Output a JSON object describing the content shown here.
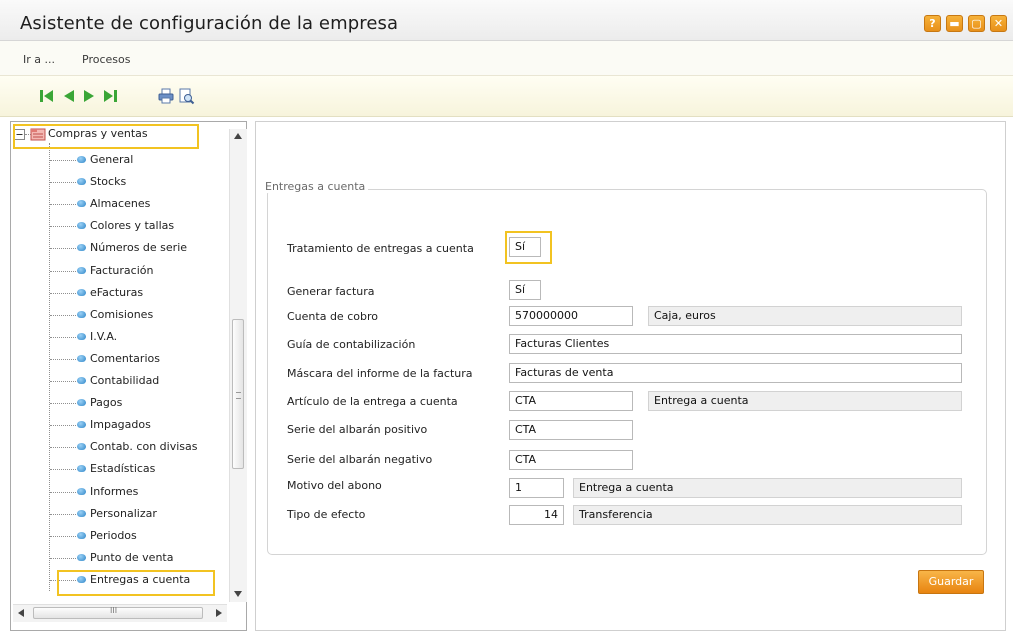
{
  "window": {
    "title": "Asistente de configuración de la empresa",
    "buttons": [
      {
        "name": "help",
        "glyph": "?"
      },
      {
        "name": "minimize",
        "glyph": "▬"
      },
      {
        "name": "maximize",
        "glyph": "▢"
      },
      {
        "name": "close",
        "glyph": "✕"
      }
    ]
  },
  "menu": {
    "items": [
      "Ir a ...",
      "Procesos"
    ]
  },
  "toolbar": {
    "icons": [
      "first-record-icon",
      "previous-record-icon",
      "next-record-icon",
      "last-record-icon",
      "print-icon",
      "print-preview-icon"
    ]
  },
  "tree": {
    "root": "Compras y ventas",
    "items": [
      "General",
      "Stocks",
      "Almacenes",
      "Colores y tallas",
      "Números de serie",
      "Facturación",
      "eFacturas",
      "Comisiones",
      "I.V.A.",
      "Comentarios",
      "Contabilidad",
      "Pagos",
      "Impagados",
      "Contab. con divisas",
      "Estadísticas",
      "Informes",
      "Personalizar",
      "Periodos",
      "Punto de venta",
      "Entregas a cuenta"
    ],
    "hscroll_mark": "III"
  },
  "form": {
    "group_title": "Entregas a cuenta",
    "tratamiento": {
      "label": "Tratamiento de entregas a cuenta",
      "value": "Sí"
    },
    "generar_factura": {
      "label": "Generar factura",
      "value": "Sí"
    },
    "cuenta_cobro": {
      "label": "Cuenta de cobro",
      "value": "570000000",
      "desc": "Caja, euros"
    },
    "guia": {
      "label": "Guía de contabilización",
      "value": "Facturas Clientes"
    },
    "mascara": {
      "label": "Máscara del informe de la factura",
      "value": "Facturas de venta"
    },
    "articulo": {
      "label": "Artículo de la entrega a cuenta",
      "value": "CTA",
      "desc": "Entrega a cuenta"
    },
    "serie_pos": {
      "label": "Serie del albarán positivo",
      "value": "CTA"
    },
    "serie_neg": {
      "label": "Serie del albarán negativo",
      "value": "CTA"
    },
    "motivo": {
      "label": "Motivo del abono",
      "value": "1",
      "desc": "Entrega a cuenta"
    },
    "tipo_efecto": {
      "label": "Tipo de efecto",
      "value": "14",
      "desc": "Transferencia"
    },
    "save_label": "Guardar"
  },
  "colors": {
    "accent": "#f2c321",
    "button_orange": "#e88410",
    "tree_leaf": "#2e86c8",
    "toolbar_green": "#3aa636"
  }
}
